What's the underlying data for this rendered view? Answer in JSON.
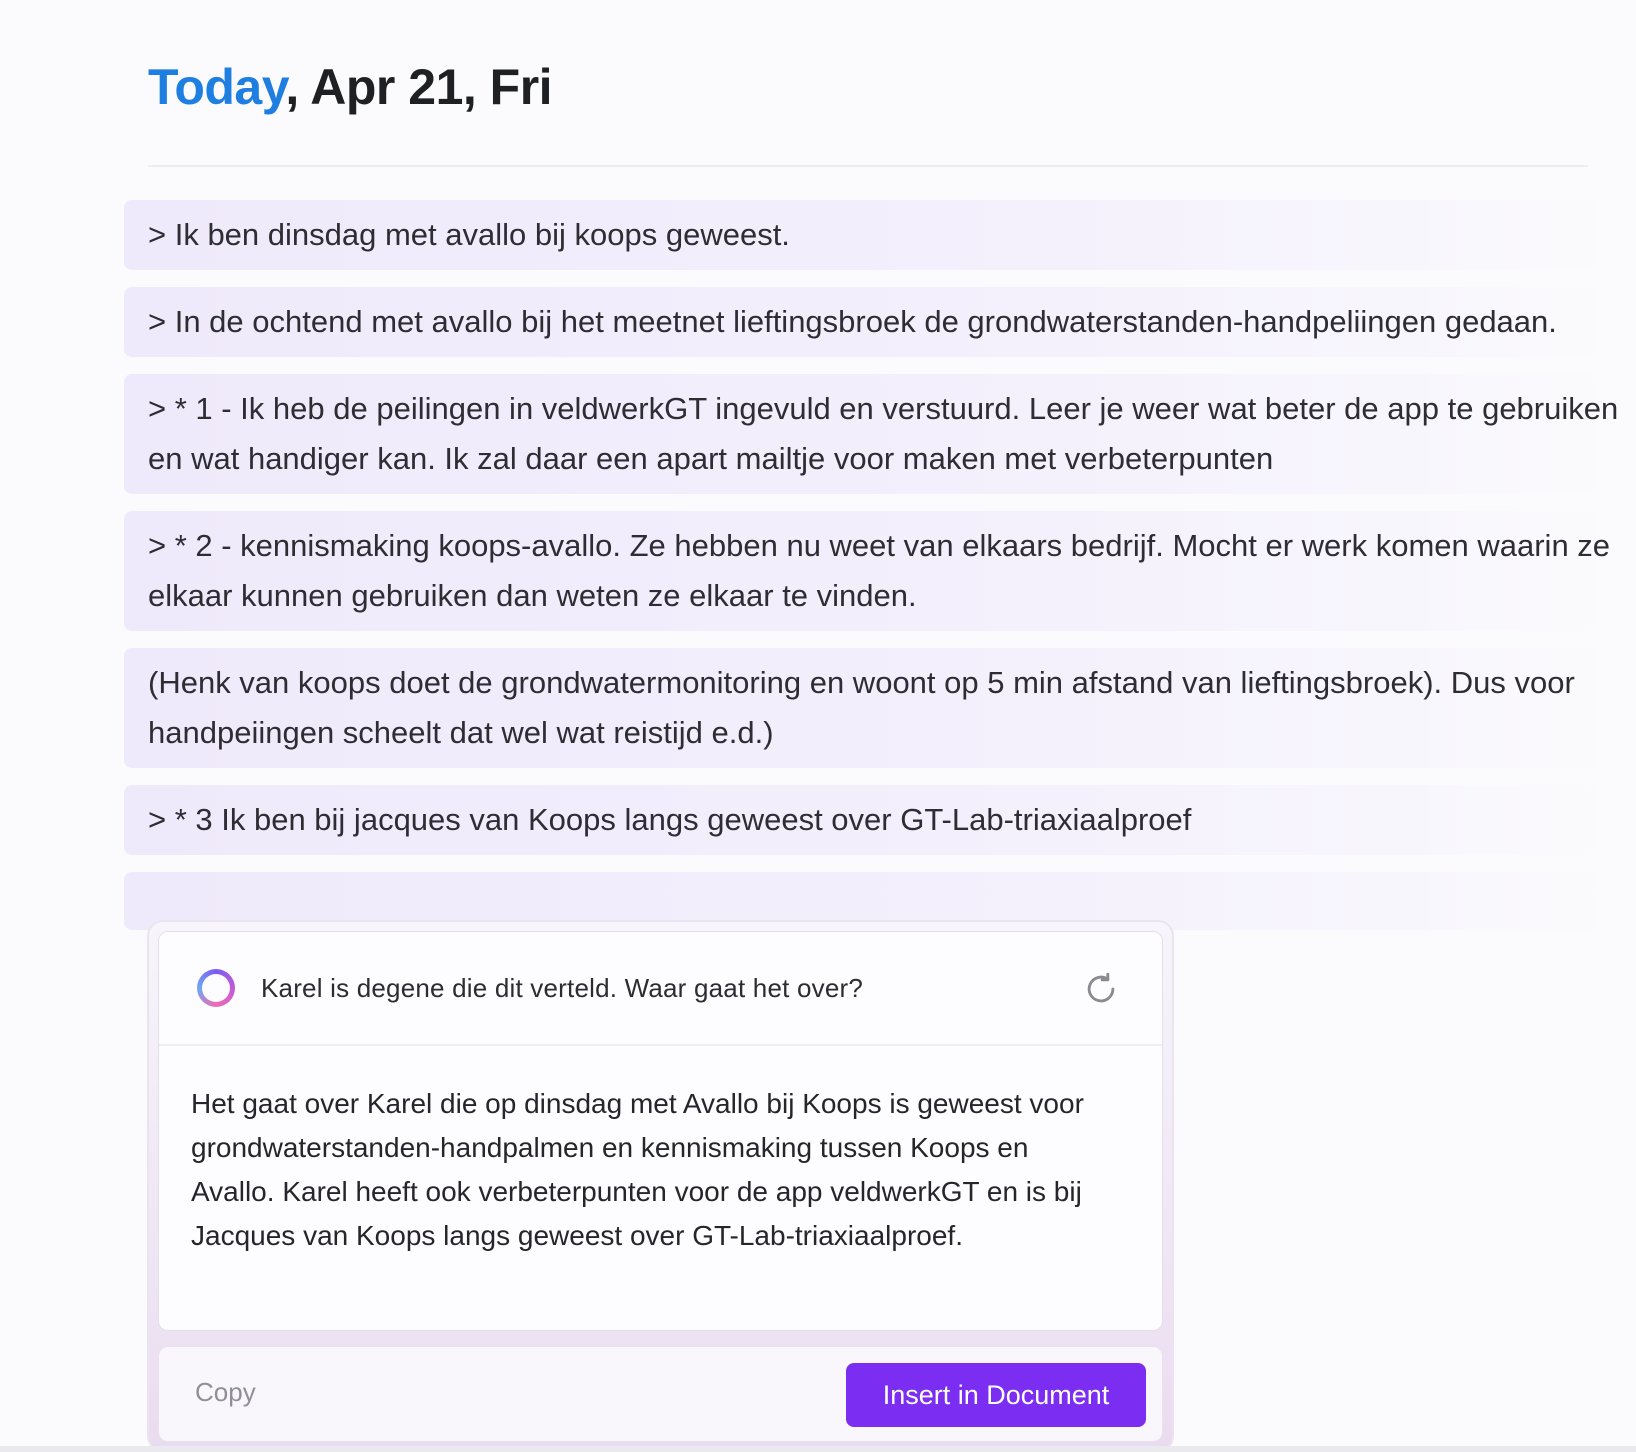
{
  "header": {
    "today_label": "Today",
    "date_label": ", Apr 21, Fri"
  },
  "blocks": [
    {
      "text": "> Ik ben dinsdag met avallo bij koops geweest."
    },
    {
      "text": "> In de ochtend met avallo bij het meetnet lieftingsbroek de grondwaterstanden-handpeliingen gedaan."
    },
    {
      "text": "> * 1 - Ik heb de peilingen in veldwerkGT ingevuld en verstuurd. Leer je weer wat beter de app te gebruiken en wat handiger kan. Ik zal daar een apart mailtje voor maken met verbeterpunten"
    },
    {
      "text": "> * 2 - kennismaking koops-avallo. Ze hebben nu weet van elkaars bedrijf. Mocht er werk komen waarin ze elkaar kunnen gebruiken dan weten ze elkaar te vinden."
    },
    {
      "text": "(Henk van koops doet de grondwatermonitoring en woont op 5 min afstand van lieftingsbroek). Dus voor handpeiingen scheelt dat wel wat reistijd e.d.)"
    },
    {
      "text": "> * 3 Ik ben bij jacques van Koops langs geweest over GT-Lab-triaxiaalproef"
    },
    {
      "text": ""
    }
  ],
  "ai_panel": {
    "question": "Karel is degene die dit verteld. Waar gaat het over?",
    "answer": "Het gaat over Karel die op dinsdag met Avallo bij Koops is geweest voor grondwaterstanden-handpalmen en kennismaking tussen Koops en Avallo. Karel heeft ook verbeterpunten voor de app veldwerkGT en is bij Jacques van Koops langs geweest over GT-Lab-triaxiaalproef.",
    "copy_label": "Copy",
    "insert_label": "Insert in Document",
    "ai_icon": "ai-ring-icon",
    "refresh_icon": "refresh-icon"
  },
  "colors": {
    "today": "#1f7fe0",
    "accent_button": "#7c2df2",
    "block_bg": "#efeafb"
  }
}
